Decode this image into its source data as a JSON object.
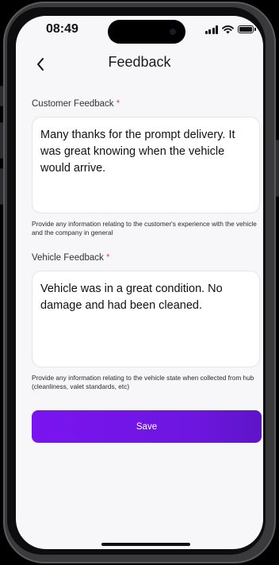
{
  "status_bar": {
    "time": "08:49"
  },
  "nav": {
    "title": "Feedback",
    "back_icon": "chevron-left-icon"
  },
  "customer_feedback": {
    "label": "Customer Feedback",
    "required_mark": "*",
    "value": "Many thanks for the prompt delivery. It was great knowing when the vehicle would arrive.",
    "helper": "Provide any information relating to the customer's experience with the vehicle and the company in general"
  },
  "vehicle_feedback": {
    "label": "Vehicle Feedback",
    "required_mark": "*",
    "value": "Vehicle was in a great condition. No damage and had been cleaned.",
    "helper": "Provide any information relating to the vehicle state when collected from hub (cleanliness, valet standards, etc)"
  },
  "save_button": {
    "label": "Save"
  },
  "colors": {
    "accent": "#7b14f0",
    "required": "#e5484d",
    "background": "#f7f7f9"
  }
}
